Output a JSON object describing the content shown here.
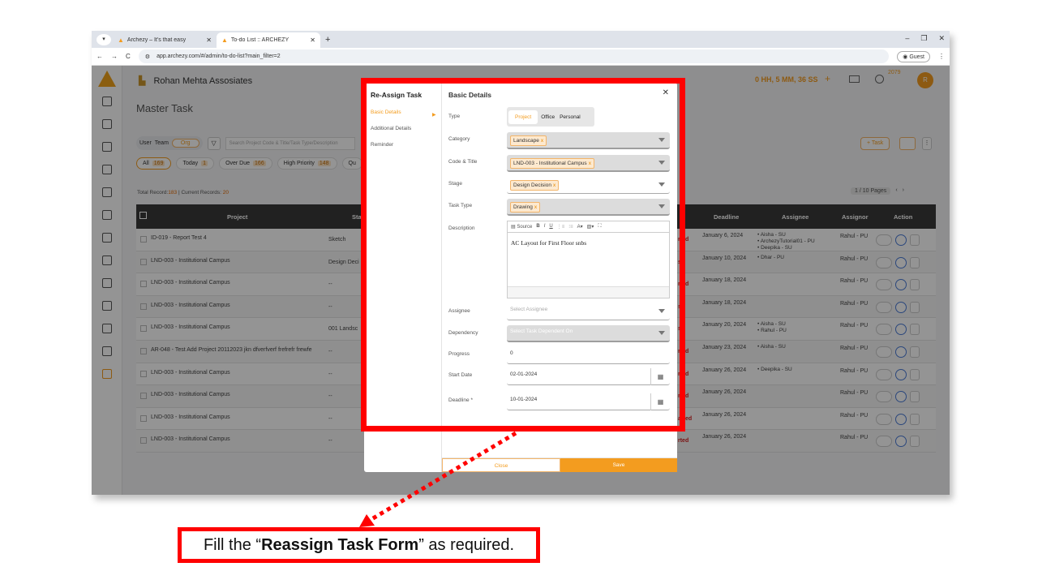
{
  "browser": {
    "tabs": [
      {
        "title": "Archezy – It's that easy"
      },
      {
        "title": "To-do List :: ARCHEZY"
      }
    ],
    "url": "app.archezy.com/#/admin/to-do-list?main_filter=2",
    "guest_label": "Guest"
  },
  "header": {
    "company": "Rohan Mehta Assosiates",
    "timer": "0 HH, 5 MM, 36 SS",
    "notif_count": "2079",
    "avatar_initial": "R"
  },
  "page": {
    "title": "Master Task",
    "segments": [
      "User",
      "Team",
      "Org"
    ],
    "search_placeholder": "Search Project Code & Title/Task Type/Description",
    "chips": [
      {
        "label": "All",
        "count": "169"
      },
      {
        "label": "Today",
        "count": "1"
      },
      {
        "label": "Over Due",
        "count": "166"
      },
      {
        "label": "High Priority",
        "count": "148"
      },
      {
        "label": "Qu",
        "count": ""
      }
    ],
    "task_button": "+ Task",
    "records_prefix": "Total Record:",
    "records_total": "183",
    "records_mid": " | Current Records: ",
    "records_current": "20",
    "pagination": "1 / 10 Pages"
  },
  "table": {
    "headers": {
      "project": "Project",
      "stage": "Sta",
      "deadline": "Deadline",
      "assignee": "Assignee",
      "assignor": "Assignor",
      "action": "Action"
    },
    "rows": [
      {
        "project": "ID-019 - Report Test 4",
        "stage": "Sketch",
        "status": "rted",
        "deadline": "January 6, 2024",
        "assignee": "• Aisha - SU\n• ArchezyTutorial01 - PU\n• Deepika - SU",
        "assignor": "Rahul - PU"
      },
      {
        "project": "LND-003 - Institutional Campus",
        "stage": "Design Deci",
        "status": "ss",
        "deadline": "January 10, 2024",
        "assignee": "• Dhar - PU",
        "assignor": "Rahul - PU"
      },
      {
        "project": "LND-003 - Institutional Campus",
        "stage": "--",
        "status": "rted",
        "deadline": "January 18, 2024",
        "assignee": "",
        "assignor": "Rahul - PU"
      },
      {
        "project": "LND-003 - Institutional Campus",
        "stage": "--",
        "status": "ss",
        "deadline": "January 18, 2024",
        "assignee": "",
        "assignor": "Rahul - PU"
      },
      {
        "project": "LND-003 - Institutional Campus",
        "stage": "001 Landsc",
        "status": "ss",
        "deadline": "January 20, 2024",
        "assignee": "• Aisha - SU\n• Rahul - PU",
        "assignor": "Rahul - PU"
      },
      {
        "project": "AR-048 - Test Add Project 20112023 jkn dfverfverf frefrefr frewfe",
        "stage": "--",
        "status": "rted",
        "deadline": "January 23, 2024",
        "assignee": "• Aisha - SU",
        "assignor": "Rahul - PU"
      },
      {
        "project": "LND-003 - Institutional Campus",
        "stage": "--",
        "status": "rted",
        "deadline": "January 26, 2024",
        "assignee": "• Deepika - SU",
        "assignor": "Rahul - PU"
      },
      {
        "project": "LND-003 - Institutional Campus",
        "stage": "--",
        "status": "rted",
        "deadline": "January 26, 2024",
        "assignee": "",
        "assignor": "Rahul - PU"
      },
      {
        "project": "LND-003 - Institutional Campus",
        "stage": "--",
        "status": "arted",
        "deadline": "January 26, 2024",
        "assignee": "",
        "assignor": "Rahul - PU"
      },
      {
        "project": "LND-003 - Institutional Campus",
        "stage": "--",
        "status": "rted",
        "deadline": "January 26, 2024",
        "assignee": "",
        "assignor": "Rahul - PU"
      }
    ]
  },
  "modal": {
    "title": "Re-Assign Task",
    "nav": [
      "Basic Details",
      "Additional Details",
      "Reminder"
    ],
    "section_title": "Basic Details",
    "labels": {
      "type": "Type",
      "category": "Category",
      "code_title": "Code & Title",
      "stage": "Stage",
      "task_type": "Task Type",
      "description": "Description",
      "assignee": "Assignee",
      "dependency": "Dependency",
      "progress": "Progress",
      "start_date": "Start Date",
      "deadline": "Deadline *"
    },
    "type_options": [
      "Project",
      "Office",
      "Personal"
    ],
    "category": "Landscape",
    "code_title": "LND-003 - Institutional Campus",
    "stage": "Design Decision",
    "task_type": "Drawing",
    "editor_source": "Source",
    "description": "AC Layout for First Floor snbs",
    "assignee_placeholder": "Select Assignee",
    "dependency_placeholder": "Select Task Dependent On",
    "progress": "0",
    "start_date": "02-01-2024",
    "deadline": "10-01-2024",
    "close_label": "Close",
    "save_label": "Save"
  },
  "annotation": {
    "pre": "Fill the “",
    "bold": "Reassign Task Form",
    "post": "” as required."
  }
}
